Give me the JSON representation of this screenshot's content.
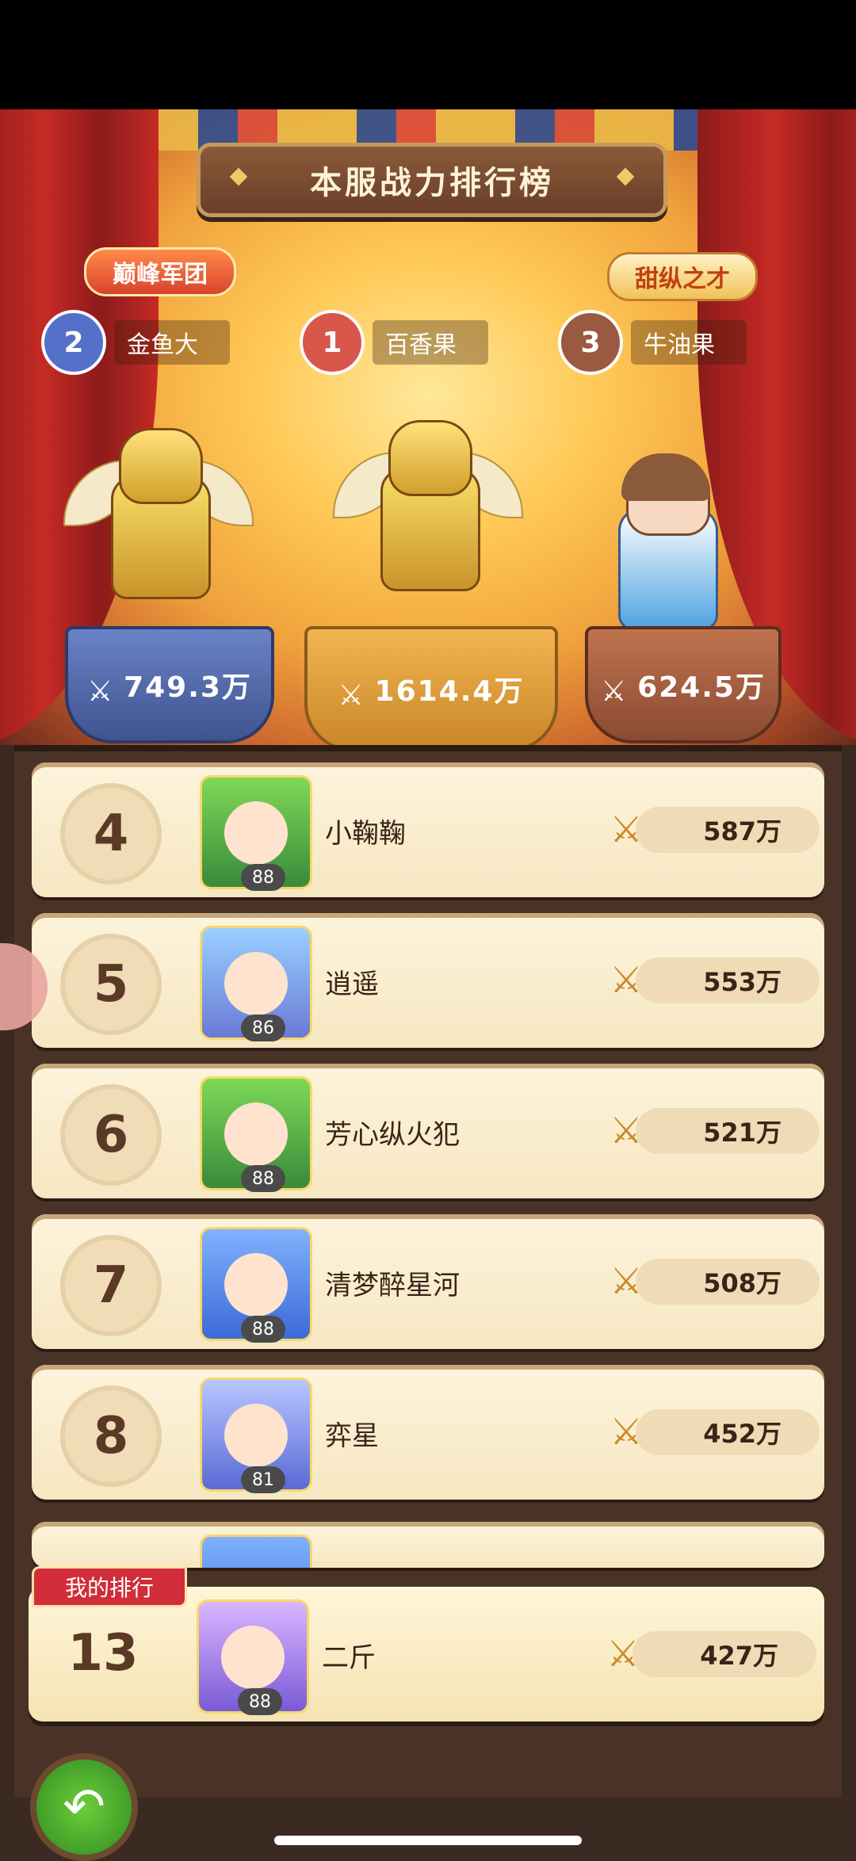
{
  "title": "本服战力排行榜",
  "badges": {
    "team": "巅峰军团",
    "sweet": "甜纵之才"
  },
  "top3": [
    {
      "rank": "2",
      "name": "金鱼大",
      "power": "749.3万"
    },
    {
      "rank": "1",
      "name": "百香果",
      "power": "1614.4万"
    },
    {
      "rank": "3",
      "name": "牛油果",
      "power": "624.5万"
    }
  ],
  "list": [
    {
      "rank": "4",
      "name": "小鞠鞠",
      "level": "88",
      "power": "587万"
    },
    {
      "rank": "5",
      "name": "逍遥",
      "level": "86",
      "power": "553万"
    },
    {
      "rank": "6",
      "name": "芳心纵火犯",
      "level": "88",
      "power": "521万"
    },
    {
      "rank": "7",
      "name": "清梦醉星河",
      "level": "88",
      "power": "508万"
    },
    {
      "rank": "8",
      "name": "弈星",
      "level": "81",
      "power": "452万"
    }
  ],
  "my_rank": {
    "label": "我的排行",
    "rank": "13",
    "name": "二斤",
    "level": "88",
    "power": "427万"
  },
  "icons": {
    "power": "crossed-swords-icon",
    "back": "back-arrow-icon"
  },
  "colors": {
    "accent_red": "#d22d3a",
    "panel_bg": "#4a3326",
    "row_bg": "#fdf4dc",
    "back_green": "#4fb62e"
  }
}
